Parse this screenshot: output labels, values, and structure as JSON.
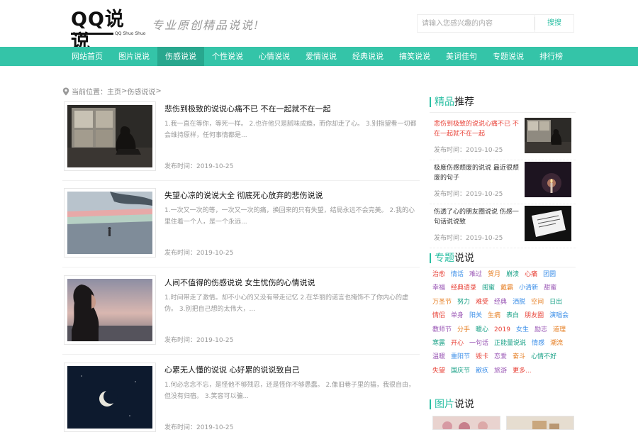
{
  "header": {
    "logo_text": "QQ说说",
    "logo_sub": "QQ Shuo Shuo",
    "slogan": "专业原创精品说说!",
    "search": {
      "placeholder": "请输入您感兴趣的内容",
      "button_label": "搜搜"
    }
  },
  "nav": {
    "items": [
      {
        "label": "网站首页",
        "active": false
      },
      {
        "label": "图片说说",
        "active": false
      },
      {
        "label": "伤感说说",
        "active": true
      },
      {
        "label": "个性说说",
        "active": false
      },
      {
        "label": "心情说说",
        "active": false
      },
      {
        "label": "爱情说说",
        "active": false
      },
      {
        "label": "经典说说",
        "active": false
      },
      {
        "label": "搞笑说说",
        "active": false
      },
      {
        "label": "美词佳句",
        "active": false
      },
      {
        "label": "专题说说",
        "active": false
      },
      {
        "label": "排行榜",
        "active": false
      }
    ]
  },
  "breadcrumb": {
    "prefix": "当前位置：",
    "home": "主页",
    "sep1": " > ",
    "current": "伤感说说",
    "sep2": " >"
  },
  "articles": [
    {
      "title": "悲伤到极致的说说心痛不已 不在一起就不在一起",
      "desc": "1.我一直在等你，等死一样。 2.也许他只是腻味成瘾，而你却走了心。 3.别指望看一切都会维持原样，任何事情都是...",
      "time": "发布时间：2019-10-25",
      "thumb_icon": "girl-window-image"
    },
    {
      "title": "失望心凉的说说大全 彻底死心放弃的悲伤说说",
      "desc": "1.一次又一次的等，一次又一次的痛，换回来的只有失望，结局永远不会完美。 2.我的心里住着一个人，是一个永远...",
      "time": "发布时间：2019-10-25",
      "thumb_icon": "anime-landscape-image"
    },
    {
      "title": "人间不值得的伤感说说 女生忧伤的心情说说",
      "desc": "1.时间带走了激情。却不小心的又没有带走记忆 2.在华丽的诺言也掩饰不了你内心的虚伪。 3.别把自己想的太伟大，...",
      "time": "发布时间：2019-10-25",
      "thumb_icon": "girl-sunset-image"
    },
    {
      "title": "心累无人懂的说说 心好累的说说致自己",
      "desc": "1.何必念念不忘，是怪他不够残忍，还是怪你不够愚蠢。 2.像旧巷子里的猫，我很自由，但没有归宿。 3.笑容可以骗...",
      "time": "发布时间：2019-10-25",
      "thumb_icon": "moon-night-image"
    }
  ],
  "sidebar": {
    "featured": {
      "title_hl": "精品",
      "title_rest": "推荐",
      "items": [
        {
          "title": "悲伤到极致的说说心痛不已 不在一起就不在一起",
          "time": "发布时间：2019-10-25",
          "highlight": true
        },
        {
          "title": "极度伤感颓废的说说 最近很颓废的句子",
          "time": "发布时间：2019-10-25",
          "highlight": false
        },
        {
          "title": "伤透了心的朋友圈说说 伤感一句话说说致",
          "time": "发布时间：2019-10-25",
          "highlight": false
        }
      ]
    },
    "topics": {
      "title_hl": "专题",
      "title_rest": "说说",
      "tags": [
        {
          "label": "治愈",
          "color": "#e8443a"
        },
        {
          "label": "情话",
          "color": "#3a8ee8"
        },
        {
          "label": "难过",
          "color": "#9b59b6"
        },
        {
          "label": "贺月",
          "color": "#e67e22"
        },
        {
          "label": "崩溃",
          "color": "#16a085"
        },
        {
          "label": "心痛",
          "color": "#e8443a"
        },
        {
          "label": "团圆",
          "color": "#3a8ee8"
        },
        {
          "label": "幸福",
          "color": "#9b59b6"
        },
        {
          "label": "经典语录",
          "color": "#e8443a"
        },
        {
          "label": "闺蜜",
          "color": "#16a085"
        },
        {
          "label": "戴霸",
          "color": "#e67e22"
        },
        {
          "label": "小清新",
          "color": "#3a8ee8"
        },
        {
          "label": "甜蜜",
          "color": "#9b59b6"
        },
        {
          "label": "万圣节",
          "color": "#e67e22"
        },
        {
          "label": "努力",
          "color": "#16a085"
        },
        {
          "label": "难受",
          "color": "#e8443a"
        },
        {
          "label": "经典",
          "color": "#9b59b6"
        },
        {
          "label": "洒脱",
          "color": "#3a8ee8"
        },
        {
          "label": "空间",
          "color": "#e67e22"
        },
        {
          "label": "日出",
          "color": "#16a085"
        },
        {
          "label": "情侣",
          "color": "#e8443a"
        },
        {
          "label": "单身",
          "color": "#9b59b6"
        },
        {
          "label": "阳关",
          "color": "#3a8ee8"
        },
        {
          "label": "生病",
          "color": "#e67e22"
        },
        {
          "label": "表白",
          "color": "#16a085"
        },
        {
          "label": "朋友圈",
          "color": "#e8443a"
        },
        {
          "label": "演唱会",
          "color": "#3a8ee8"
        },
        {
          "label": "教师节",
          "color": "#9b59b6"
        },
        {
          "label": "分手",
          "color": "#e67e22"
        },
        {
          "label": "暖心",
          "color": "#16a085"
        },
        {
          "label": "2019",
          "color": "#e8443a"
        },
        {
          "label": "女生",
          "color": "#3a8ee8"
        },
        {
          "label": "励志",
          "color": "#9b59b6"
        },
        {
          "label": "道理",
          "color": "#e67e22"
        },
        {
          "label": "寒露",
          "color": "#16a085"
        },
        {
          "label": "开心",
          "color": "#e8443a"
        },
        {
          "label": "一句话",
          "color": "#9b59b6"
        },
        {
          "label": "正能量说说",
          "color": "#16a085"
        },
        {
          "label": "情感",
          "color": "#3a8ee8"
        },
        {
          "label": "潮流",
          "color": "#e67e22"
        },
        {
          "label": "温暖",
          "color": "#9b59b6"
        },
        {
          "label": "重阳节",
          "color": "#3a8ee8"
        },
        {
          "label": "毁卡",
          "color": "#e8443a"
        },
        {
          "label": "恋爱",
          "color": "#9b59b6"
        },
        {
          "label": "奋斗",
          "color": "#e67e22"
        },
        {
          "label": "心情不好",
          "color": "#16a085"
        },
        {
          "label": "失望",
          "color": "#e8443a"
        },
        {
          "label": "国庆节",
          "color": "#16a085"
        },
        {
          "label": "歉疚",
          "color": "#3a8ee8"
        },
        {
          "label": "旅游",
          "color": "#9b59b6"
        },
        {
          "label": "更多...",
          "color": "#e8443a"
        }
      ]
    },
    "pictures": {
      "title_hl": "图片",
      "title_rest": "说说"
    }
  }
}
